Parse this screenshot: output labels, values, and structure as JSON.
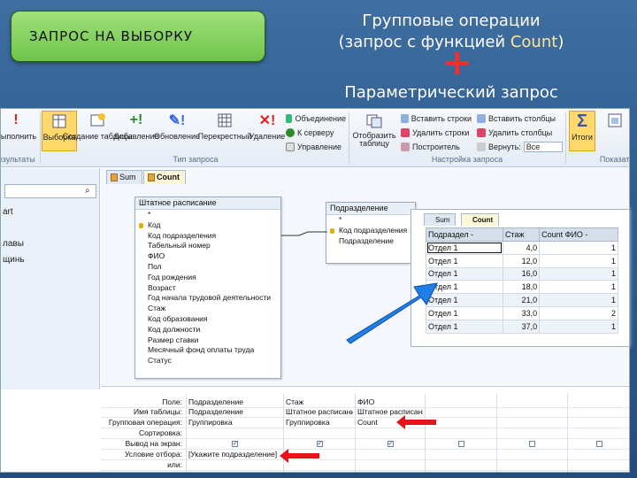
{
  "slide": {
    "badge_text": "ЗАПРОС НА ВЫБОРКУ",
    "heading_line1": "Групповые операции",
    "heading_line2_prefix": "(запрос с функцией ",
    "heading_line2_highlight": "Count",
    "heading_line2_suffix": ")",
    "plus_sign": "+",
    "subheading": "Параметрический запрос"
  },
  "ribbon": {
    "buttons": [
      {
        "label": "Выполнить",
        "icon": "run-icon"
      },
      {
        "label": "Выборка",
        "icon": "select-query-icon"
      },
      {
        "label": "Создание таблицы",
        "icon": "make-table-icon"
      },
      {
        "label": "Добавление",
        "icon": "append-icon"
      },
      {
        "label": "Обновление",
        "icon": "update-icon"
      },
      {
        "label": "Перекрестный",
        "icon": "crosstab-icon"
      },
      {
        "label": "Удаление",
        "icon": "delete-icon"
      }
    ],
    "small_cmds": [
      "Объединение",
      "К серверу",
      "Управление"
    ],
    "show_table": "Отобразить таблицу",
    "setup_cmds": [
      "Вставить строки",
      "Удалить строки",
      "Построитель"
    ],
    "col_cmds": [
      "Вставить столбцы",
      "Удалить столбцы"
    ],
    "return_label": "Вернуть:",
    "return_value": "Все",
    "totals": "Итоги",
    "group_labels": [
      "Результаты",
      "Тип запроса",
      "Настройка запроса",
      "Показать"
    ]
  },
  "nav": {
    "lines": [
      "art",
      "лавы",
      "щинь"
    ]
  },
  "tabs": {
    "sum": "Sum",
    "count": "Count"
  },
  "staff_table": {
    "title": "Штатное расписание",
    "fields": [
      "*",
      "Код",
      "Код подразделения",
      "Табельный номер",
      "ФИО",
      "Пол",
      "Год рождения",
      "Возраст",
      "Год начала трудовой деятельности",
      "Стаж",
      "Код образования",
      "Код должности",
      "Размер ставки",
      "Месячный фонд оплаты труда",
      "Статус"
    ]
  },
  "dept_table": {
    "title": "Подразделение",
    "fields": [
      "*",
      "Код подразделения",
      "Подразделение"
    ]
  },
  "result": {
    "tabs": [
      "Sum",
      "Count"
    ],
    "headers": [
      "Подраздел -",
      "Стаж",
      "Count ФИО -"
    ],
    "rows": [
      [
        "Отдел 1",
        "4,0",
        "1"
      ],
      [
        "Отдел 1",
        "12,0",
        "1"
      ],
      [
        "Отдел 1",
        "16,0",
        "1"
      ],
      [
        "Отдел 1",
        "18,0",
        "1"
      ],
      [
        "Отдел 1",
        "21,0",
        "1"
      ],
      [
        "Отдел 1",
        "33,0",
        "2"
      ],
      [
        "Отдел 1",
        "37,0",
        "1"
      ]
    ]
  },
  "qbe": {
    "row_labels": [
      "Поле:",
      "Имя таблицы:",
      "Групповая операция:",
      "Сортировка:",
      "Вывод на экран:",
      "Условие отбора:",
      "или:"
    ],
    "columns": [
      {
        "field": "Подразделение",
        "table": "Подразделение",
        "total": "Группировка",
        "criteria": "[Укажите подразделение]",
        "show": true
      },
      {
        "field": "Стаж",
        "table": "Штатное расписание",
        "total": "Группировка",
        "criteria": "",
        "show": true
      },
      {
        "field": "ФИО",
        "table": "Штатное расписание",
        "total": "Count",
        "criteria": "",
        "show": true
      },
      {
        "field": "",
        "table": "",
        "total": "",
        "criteria": "",
        "show": false
      },
      {
        "field": "",
        "table": "",
        "total": "",
        "criteria": "",
        "show": false
      },
      {
        "field": "",
        "table": "",
        "total": "",
        "criteria": "",
        "show": false
      }
    ]
  },
  "colors": {
    "background": "#2f5d8f",
    "badge": "#7dcc55",
    "highlight_text": "#ffe69a",
    "red_accent": "#e8141a",
    "blue_arrow": "#1f7fe6"
  }
}
